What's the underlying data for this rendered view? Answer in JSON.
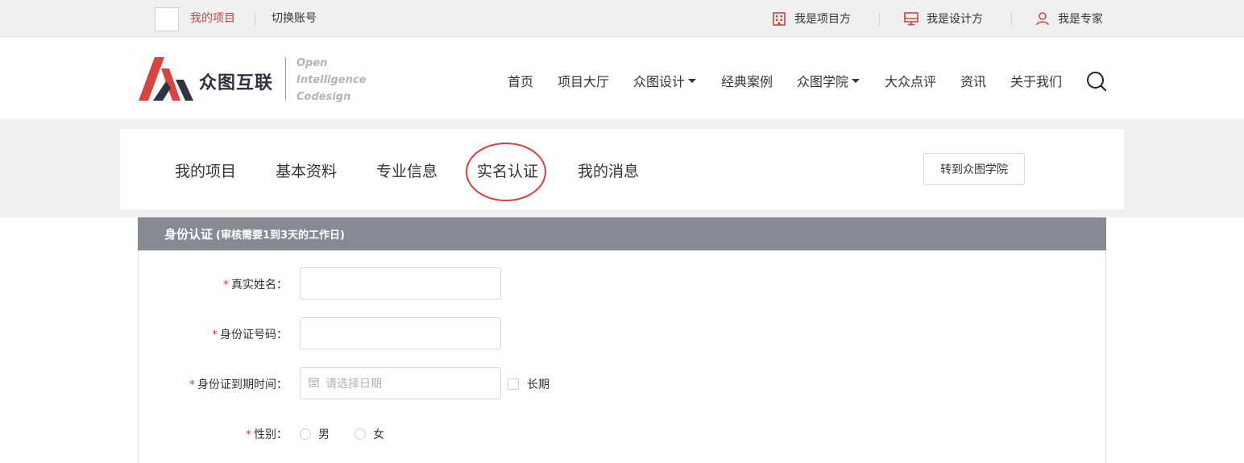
{
  "topbar": {
    "my_projects": "我的项目",
    "switch_account": "切换账号",
    "roles": [
      {
        "label": "我是项目方",
        "icon": "building-icon"
      },
      {
        "label": "我是设计方",
        "icon": "monitor-icon"
      },
      {
        "label": "我是专家",
        "icon": "user-icon"
      }
    ]
  },
  "header": {
    "logo_name": "众图互联",
    "logo_tagline": [
      "Open",
      "Intelligence",
      "Codesign"
    ],
    "nav": [
      {
        "label": "首页",
        "dropdown": false
      },
      {
        "label": "项目大厅",
        "dropdown": false
      },
      {
        "label": "众图设计",
        "dropdown": true
      },
      {
        "label": "经典案例",
        "dropdown": false
      },
      {
        "label": "众图学院",
        "dropdown": true
      },
      {
        "label": "大众点评",
        "dropdown": false
      },
      {
        "label": "资讯",
        "dropdown": false
      },
      {
        "label": "关于我们",
        "dropdown": false
      }
    ]
  },
  "tabs": {
    "items": [
      "我的项目",
      "基本资料",
      "专业信息",
      "实名认证",
      "我的消息"
    ],
    "active": "实名认证",
    "go_academy": "转到众图学院"
  },
  "panel": {
    "title": "身份认证",
    "subtitle": "(审核需要1到3天的工作日)"
  },
  "form": {
    "required_mark": "*",
    "real_name_label": "真实姓名：",
    "real_name_value": "",
    "id_number_label": "身份证号码：",
    "id_number_value": "",
    "id_expiry_label": "身份证到期时间：",
    "id_expiry_placeholder": "请选择日期",
    "long_term_label": "长期",
    "gender_label": "性别：",
    "gender_options": [
      "男",
      "女"
    ]
  },
  "colors": {
    "accent_red": "#c8453f",
    "panel_header": "#878a92",
    "annotation_circle": "#e03a3a"
  }
}
